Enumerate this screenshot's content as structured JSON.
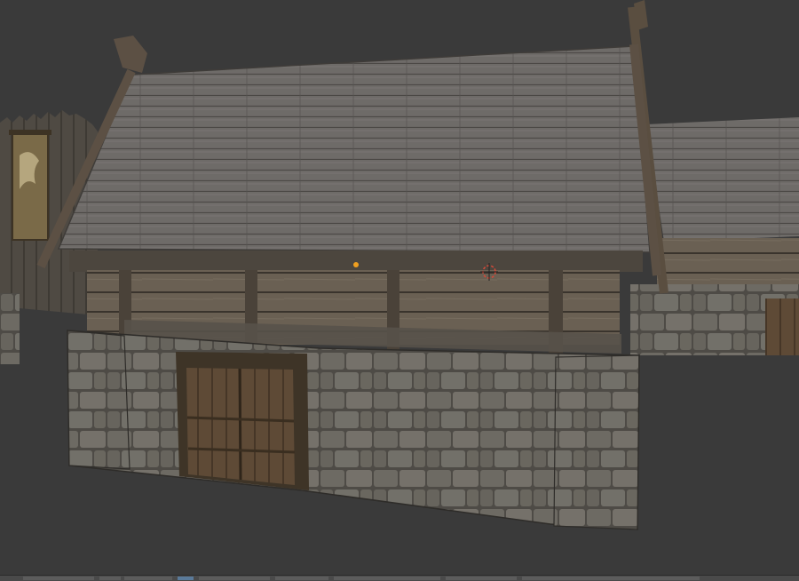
{
  "window": {
    "kind": "3d-viewport",
    "background": "#3a3a3a"
  },
  "scene": {
    "main_building": {
      "roof_color": "#6e6b68",
      "log_wall_color": "#5a5146",
      "stone_color": "#6d6a63",
      "door_color": "#5e4a36"
    },
    "side_building": {
      "roof_color": "#6a6764",
      "stone_color": "#66625c"
    },
    "palisade": {
      "wood_color": "#4f4a43",
      "banner_color": "#7a6a48"
    }
  },
  "cursor": {
    "type": "3d-cursor",
    "color": "#d04a3a"
  },
  "selection_dot": {
    "color": "#f0a020"
  },
  "statusbar": {
    "color": "#4a4a4a"
  }
}
